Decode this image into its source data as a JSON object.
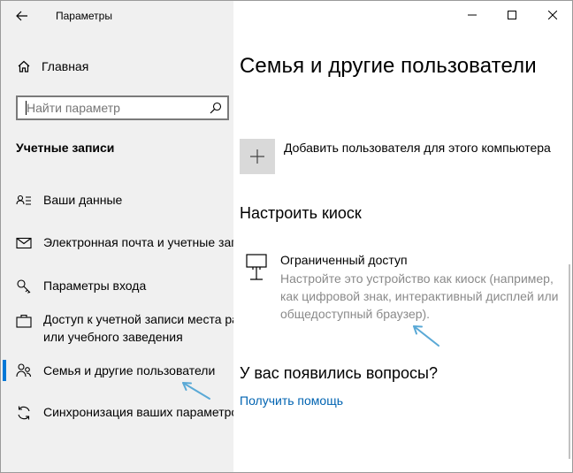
{
  "titlebar": {
    "app_title": "Параметры",
    "back_icon": "back-arrow-icon",
    "minimize_icon": "minimize-icon",
    "maximize_icon": "maximize-icon",
    "close_icon": "close-icon"
  },
  "sidebar": {
    "home_label": "Главная",
    "search_placeholder": "Найти параметр",
    "section_title": "Учетные записи",
    "items": [
      {
        "label": "Ваши данные",
        "icon": "user-card-icon",
        "selected": false
      },
      {
        "label": "Электронная почта и учетные записи",
        "icon": "mail-icon",
        "selected": false
      },
      {
        "label": "Параметры входа",
        "icon": "key-icon",
        "selected": false
      },
      {
        "label": "Доступ к учетной записи места работы",
        "label2": "или учебного заведения",
        "icon": "briefcase-icon",
        "selected": false
      },
      {
        "label": "Семья и другие пользователи",
        "icon": "people-icon",
        "selected": true
      },
      {
        "label": "Синхронизация ваших параметров",
        "icon": "sync-icon",
        "selected": false
      }
    ]
  },
  "main": {
    "page_title": "Семья и другие пользователи",
    "add_user_label": "Добавить пользователя для этого компьютера",
    "kiosk_section_title": "Настроить киоск",
    "kiosk": {
      "name": "Ограниченный доступ",
      "description": "Настройте это устройство как киоск (например, как цифровой знак, интерактивный дисплей или общедоступный браузер)."
    },
    "questions_title": "У вас появились вопросы?",
    "help_link": "Получить помощь"
  },
  "colors": {
    "accent": "#0078d7",
    "link": "#0063b1",
    "sidebar_bg": "#f0f0f0",
    "annotation_arrow": "#5aa9d6"
  }
}
